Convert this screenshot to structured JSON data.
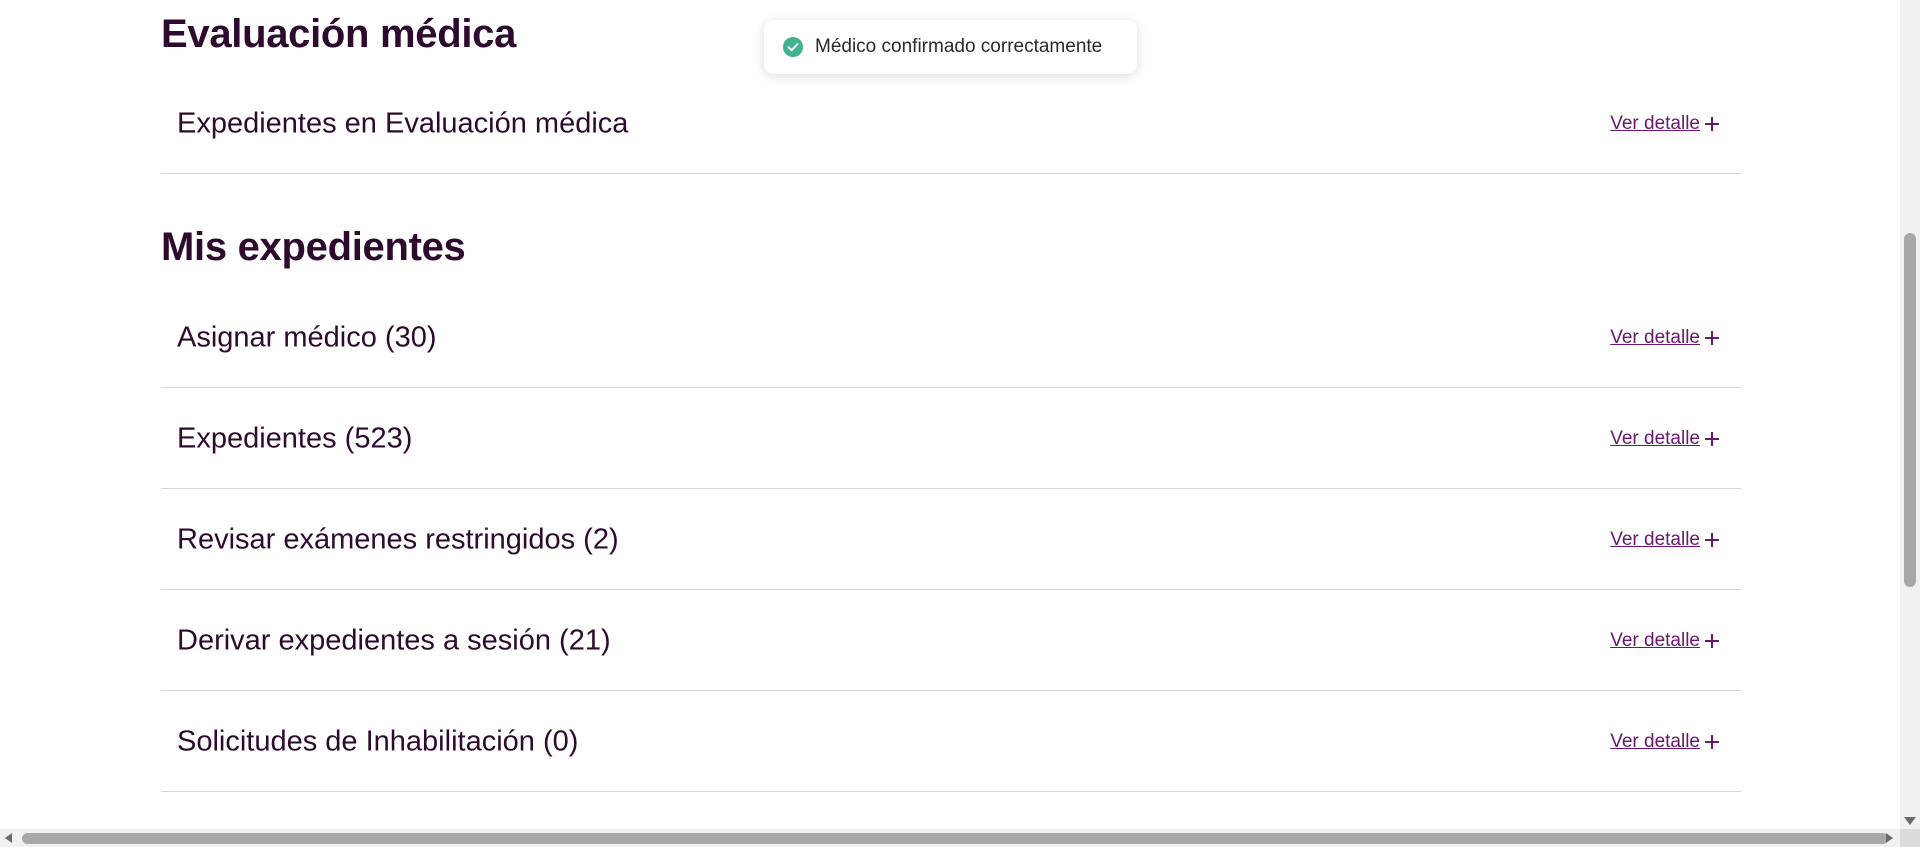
{
  "toast": {
    "message": "Médico confirmado correctamente",
    "icon": "check-circle-icon",
    "icon_color": "#3fb28f"
  },
  "colors": {
    "heading": "#2d0a2e",
    "link": "#6b1670",
    "divider": "#d6d6d6"
  },
  "sections": [
    {
      "title": "Evaluación médica",
      "rows": [
        {
          "label": "Expedientes en Evaluación médica",
          "link": "Ver detalle"
        }
      ]
    },
    {
      "title": "Mis expedientes",
      "rows": [
        {
          "label": "Asignar médico (30)",
          "link": "Ver detalle"
        },
        {
          "label": "Expedientes (523)",
          "link": "Ver detalle"
        },
        {
          "label": "Revisar exámenes restringidos (2)",
          "link": "Ver detalle"
        },
        {
          "label": "Derivar expedientes a sesión (21)",
          "link": "Ver detalle"
        },
        {
          "label": "Solicitudes de Inhabilitación (0)",
          "link": "Ver detalle"
        }
      ]
    }
  ]
}
